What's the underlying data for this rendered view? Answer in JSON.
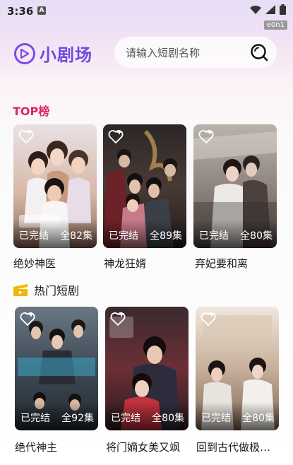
{
  "status_bar": {
    "time": "3:36",
    "notification_letter": "A",
    "badge": "e0n1"
  },
  "header": {
    "app_name": "小剧场"
  },
  "search": {
    "placeholder": "请输入短剧名称"
  },
  "top_section": {
    "title": "TOP榜",
    "items": [
      {
        "title": "绝妙神医",
        "status": "已完结",
        "episodes": "全82集"
      },
      {
        "title": "神龙狂婿",
        "status": "已完结",
        "episodes": "全89集"
      },
      {
        "title": "弃妃要和离",
        "status": "已完结",
        "episodes": "全80集"
      }
    ]
  },
  "hot_section": {
    "title": "热门短剧",
    "items": [
      {
        "title": "绝代神主",
        "status": "已完结",
        "episodes": "全92集"
      },
      {
        "title": "将门嫡女美又飒",
        "status": "已完结",
        "episodes": "全80集"
      },
      {
        "title": "回到古代做极…",
        "status": "已完结",
        "episodes": "全80集"
      }
    ]
  },
  "colors": {
    "brand": "#7346e3",
    "top_title": "#e0245e",
    "hot_icon": "#f2b705"
  }
}
